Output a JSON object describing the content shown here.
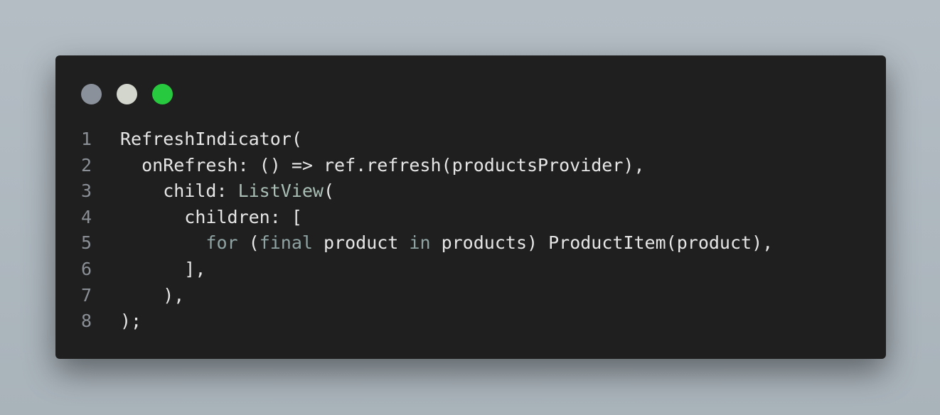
{
  "window": {
    "controls": [
      {
        "name": "close",
        "color": "#8b919b"
      },
      {
        "name": "minimize",
        "color": "#d3d6cd"
      },
      {
        "name": "maximize",
        "color": "#27c93f"
      }
    ]
  },
  "colors": {
    "background": "#a9b3ba",
    "editor": "#1f1f1f",
    "text": "#e6e6e6",
    "line_number": "#8a8f96",
    "type": "#a9bfb6",
    "keyword": "#8fa3a3"
  },
  "code": {
    "lines": [
      {
        "num": "1",
        "tokens": [
          {
            "text": "RefreshIndicator(",
            "kind": "plain"
          }
        ]
      },
      {
        "num": "2",
        "tokens": [
          {
            "text": "  onRefresh: () => ref.refresh(productsProvider),",
            "kind": "plain"
          }
        ]
      },
      {
        "num": "3",
        "tokens": [
          {
            "text": "    child: ",
            "kind": "plain"
          },
          {
            "text": "ListView",
            "kind": "type"
          },
          {
            "text": "(",
            "kind": "plain"
          }
        ]
      },
      {
        "num": "4",
        "tokens": [
          {
            "text": "      children: [",
            "kind": "plain"
          }
        ]
      },
      {
        "num": "5",
        "tokens": [
          {
            "text": "        ",
            "kind": "plain"
          },
          {
            "text": "for",
            "kind": "keyword"
          },
          {
            "text": " (",
            "kind": "plain"
          },
          {
            "text": "final",
            "kind": "keyword"
          },
          {
            "text": " product ",
            "kind": "plain"
          },
          {
            "text": "in",
            "kind": "keyword"
          },
          {
            "text": " products) ProductItem(product),",
            "kind": "plain"
          }
        ]
      },
      {
        "num": "6",
        "tokens": [
          {
            "text": "      ],",
            "kind": "plain"
          }
        ]
      },
      {
        "num": "7",
        "tokens": [
          {
            "text": "    ),",
            "kind": "plain"
          }
        ]
      },
      {
        "num": "8",
        "tokens": [
          {
            "text": ");",
            "kind": "plain"
          }
        ]
      }
    ]
  }
}
